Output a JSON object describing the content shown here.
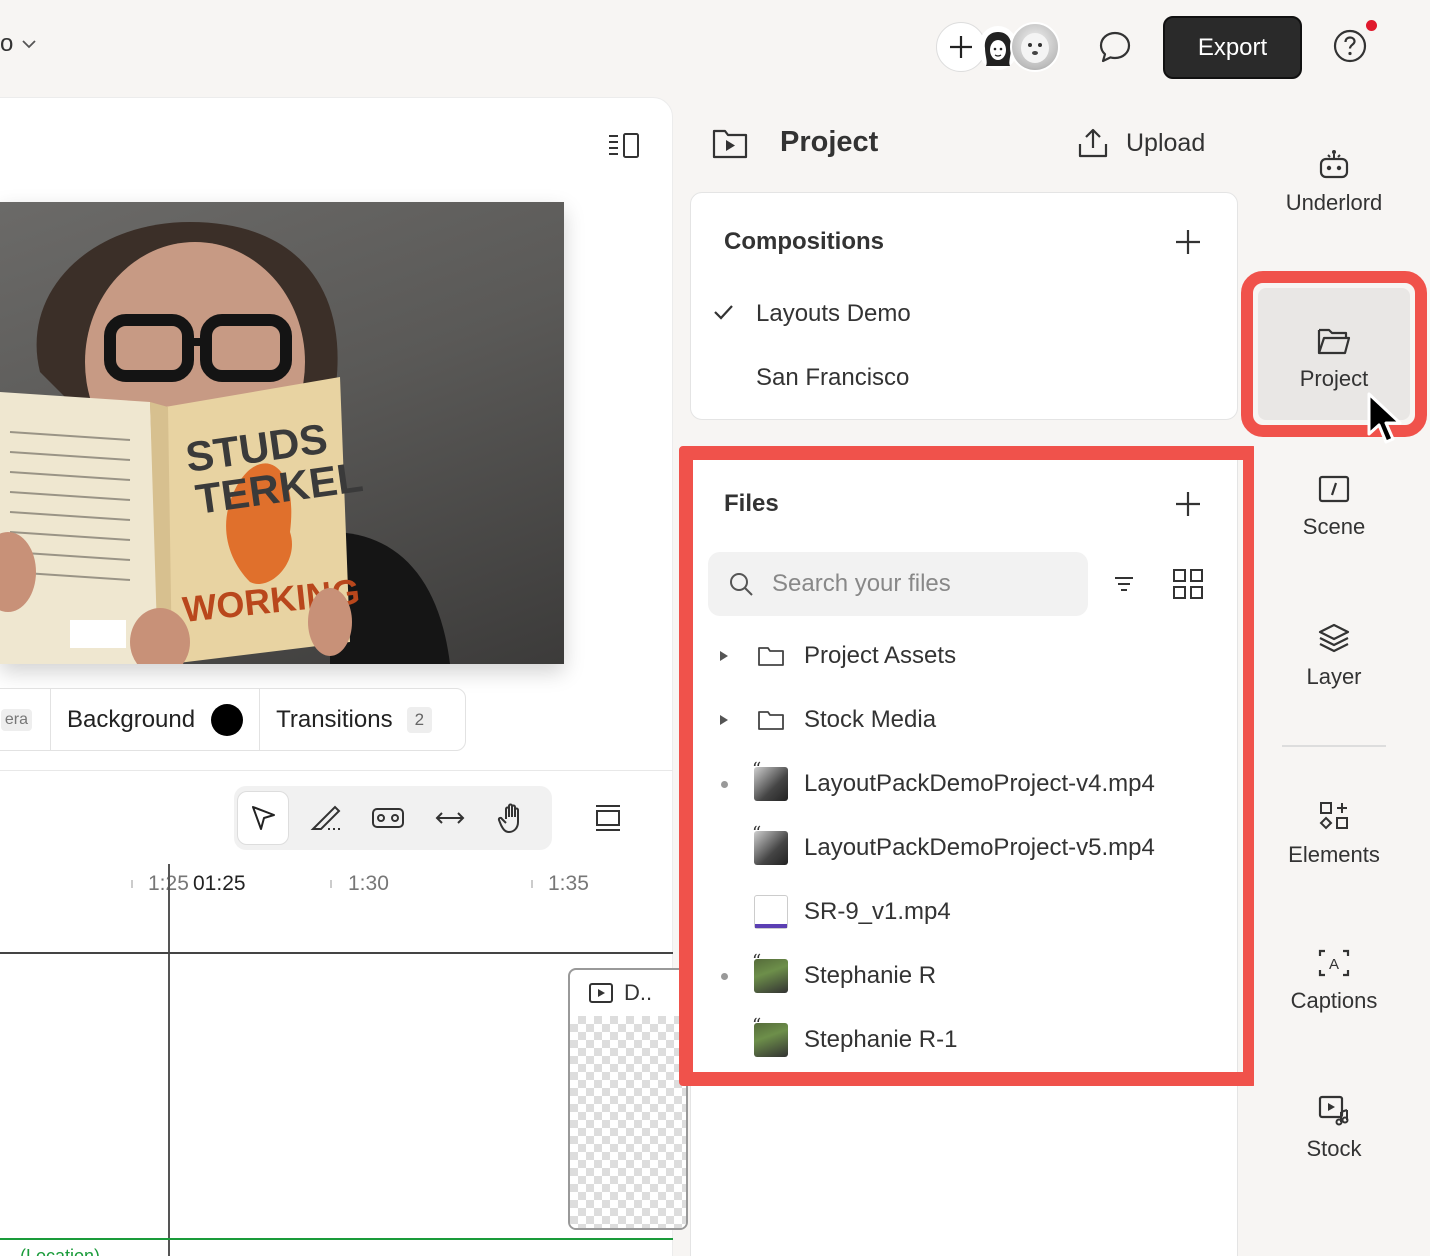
{
  "topbar": {
    "project_name": "o",
    "export_label": "Export"
  },
  "editor": {
    "tabs": {
      "camera_label": "era",
      "background_label": "Background",
      "background_color": "#000000",
      "transitions_label": "Transitions",
      "transitions_count": "2"
    },
    "ruler": {
      "t1": "1:25",
      "playhead_time": "01:25",
      "t2": "1:30",
      "t3": "1:35"
    },
    "clip_label": "D..",
    "track_label": "(Location)"
  },
  "project_panel": {
    "title": "Project",
    "upload_label": "Upload",
    "compositions": {
      "title": "Compositions",
      "items": [
        {
          "label": "Layouts Demo",
          "checked": true
        },
        {
          "label": "San Francisco",
          "checked": false
        }
      ]
    },
    "files": {
      "title": "Files",
      "search_placeholder": "Search your files",
      "items": [
        {
          "label": "Project Assets",
          "type": "folder"
        },
        {
          "label": "Stock Media",
          "type": "folder"
        },
        {
          "label": "LayoutPackDemoProject-v4.mp4",
          "type": "video"
        },
        {
          "label": "LayoutPackDemoProject-v5.mp4",
          "type": "video"
        },
        {
          "label": "SR-9_v1.mp4",
          "type": "doc-video"
        },
        {
          "label": "Stephanie R",
          "type": "speaker"
        },
        {
          "label": "Stephanie R-1",
          "type": "speaker"
        }
      ]
    }
  },
  "sidebar": {
    "items": [
      {
        "label": "Underlord",
        "icon": "robot-icon"
      },
      {
        "label": "Project",
        "icon": "folder-open-icon",
        "selected": true
      },
      {
        "label": "Scene",
        "icon": "scene-icon"
      },
      {
        "label": "Layer",
        "icon": "layers-icon"
      },
      {
        "label": "Elements",
        "icon": "shapes-icon"
      },
      {
        "label": "Captions",
        "icon": "captions-icon"
      },
      {
        "label": "Stock",
        "icon": "stock-media-icon"
      }
    ]
  },
  "colors": {
    "highlight": "#f0524b",
    "export_bg": "#2a2a2a",
    "notification": "#e0192c",
    "track_green": "#1a9b3a"
  }
}
